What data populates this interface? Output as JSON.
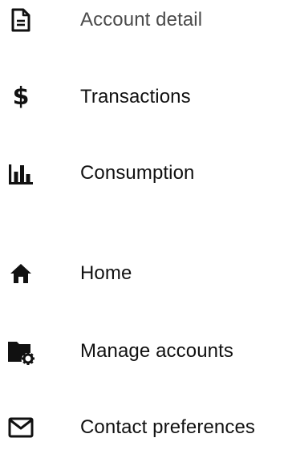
{
  "menu": {
    "items": [
      {
        "icon": "description-icon",
        "label": "Account detail"
      },
      {
        "icon": "dollar-icon",
        "glyph": "$",
        "label": "Transactions"
      },
      {
        "icon": "bar-chart-icon",
        "label": "Consumption"
      },
      {
        "icon": "home-icon",
        "label": "Home"
      },
      {
        "icon": "folder-settings-icon",
        "label": "Manage accounts"
      },
      {
        "icon": "mail-icon",
        "label": "Contact preferences"
      }
    ]
  },
  "colors": {
    "text": "#111111",
    "text_muted": "#4b4b4b",
    "icon": "#111111",
    "background": "#ffffff"
  }
}
